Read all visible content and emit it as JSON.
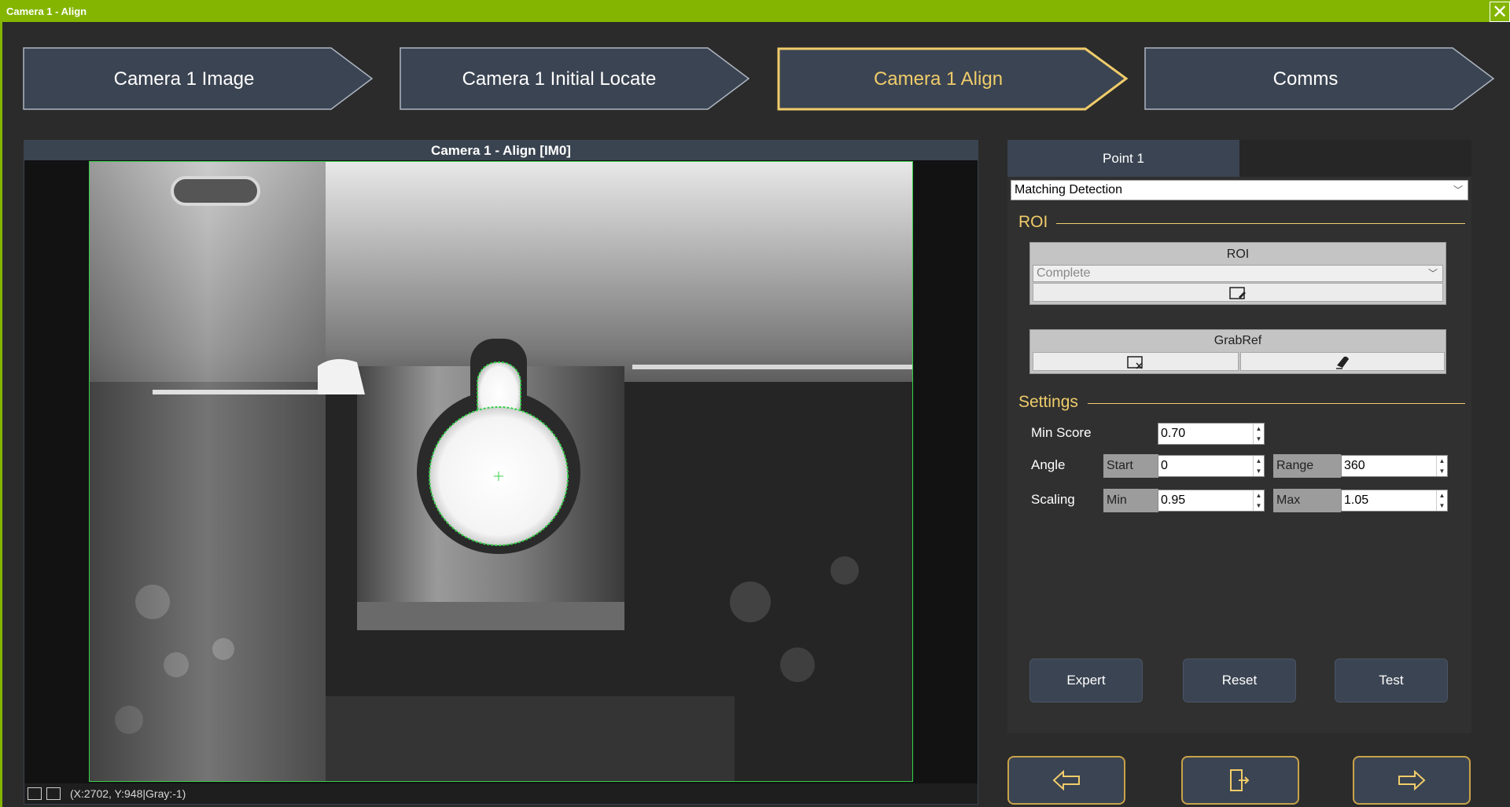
{
  "window": {
    "title": "Camera 1 - Align",
    "close_glyph": "✕"
  },
  "steps": [
    {
      "label": "Camera 1 Image",
      "active": false
    },
    {
      "label": "Camera 1 Initial Locate",
      "active": false
    },
    {
      "label": "Camera 1 Align",
      "active": true
    },
    {
      "label": "Comms",
      "active": false
    }
  ],
  "image_panel": {
    "header": "Camera 1 - Align  [IM0]",
    "status_text": "(X:2702, Y:948|Gray:-1)"
  },
  "right_panel": {
    "tabs": [
      {
        "label": "Point 1",
        "active": true
      }
    ],
    "method_select": {
      "value": "Matching Detection"
    },
    "roi_section": {
      "title": "ROI",
      "group_title": "ROI",
      "roi_select": {
        "value": "Complete"
      }
    },
    "grabref": {
      "group_title": "GrabRef"
    },
    "settings_section": {
      "title": "Settings",
      "min_score": {
        "label": "Min Score",
        "value": "0.70"
      },
      "angle": {
        "label": "Angle",
        "start_label": "Start",
        "start_value": "0",
        "range_label": "Range",
        "range_value": "360"
      },
      "scaling": {
        "label": "Scaling",
        "min_label": "Min",
        "min_value": "0.95",
        "max_label": "Max",
        "max_value": "1.05"
      }
    },
    "actions": {
      "expert": "Expert",
      "reset": "Reset",
      "test": "Test"
    }
  },
  "colors": {
    "titlebar": "#84b500",
    "accent": "#f0cc6a",
    "panel": "#3b4452",
    "roi_outline": "#37d04a"
  },
  "icons": {
    "roi_edit": "roi-edit-icon",
    "grab_select": "grab-select-icon",
    "grab_erase": "eraser-icon",
    "nav_prev": "arrow-left-icon",
    "nav_exit": "exit-door-icon",
    "nav_next": "arrow-right-icon"
  }
}
